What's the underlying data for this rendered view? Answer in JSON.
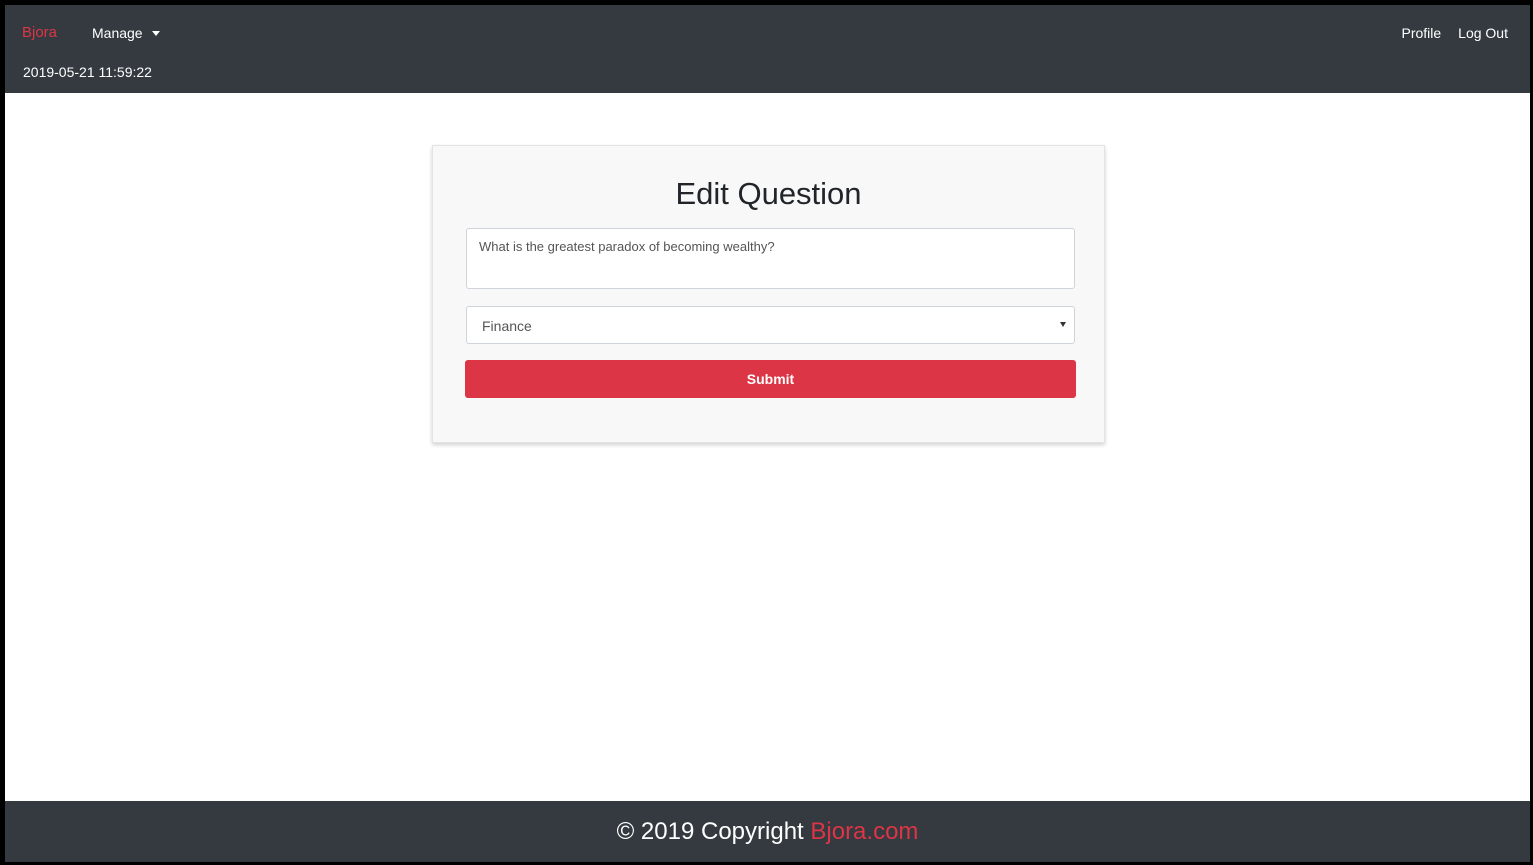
{
  "navbar": {
    "brand": "Bjora",
    "manage_label": "Manage",
    "datetime": "2019-05-21 11:59:22",
    "profile_label": "Profile",
    "logout_label": "Log Out"
  },
  "form": {
    "title": "Edit Question",
    "question_value": "What is the greatest paradox of becoming wealthy?",
    "category_value": "Finance",
    "submit_label": "Submit"
  },
  "footer": {
    "copyright_text": "© 2019 Copyright",
    "link_text": "Bjora.com"
  },
  "colors": {
    "navbar_bg": "#343a40",
    "accent": "#dc3545",
    "card_bg": "#f8f8f8"
  },
  "icons": {
    "manage_dropdown": "caret-down-icon",
    "select_arrow": "select-arrow-icon"
  }
}
